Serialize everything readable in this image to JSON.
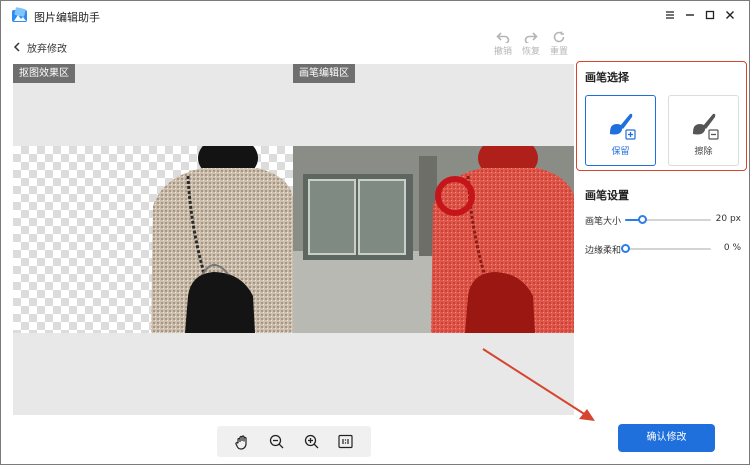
{
  "app": {
    "title": "图片编辑助手",
    "window_controls": [
      "minimize",
      "restore",
      "maximize",
      "close"
    ]
  },
  "toolbar": {
    "back_label": "放弃修改",
    "undo_label": "撤销",
    "redo_label": "恢复",
    "reset_label": "重置"
  },
  "canvas": {
    "left_pane_label": "抠图效果区",
    "right_pane_label": "画笔编辑区",
    "highlight_color": "#e45a4b"
  },
  "zoom_toolbar": {
    "hand_icon": "hand-icon",
    "zoom_out_icon": "zoom-out-icon",
    "zoom_in_icon": "zoom-in-icon",
    "actual_size_label": "1:1"
  },
  "brush_select": {
    "title": "画笔选择",
    "keep_label": "保留",
    "erase_label": "擦除",
    "selected": "保留"
  },
  "brush_settings": {
    "title": "画笔设置",
    "size_label": "画笔大小",
    "size_value": "20 px",
    "size_fraction": 0.2,
    "feather_label": "边缘柔和",
    "feather_value": "0 %",
    "feather_fraction": 0
  },
  "confirm_label": "确认修改",
  "colors": {
    "accent": "#1f6fdc",
    "annotation": "#d6452f"
  }
}
